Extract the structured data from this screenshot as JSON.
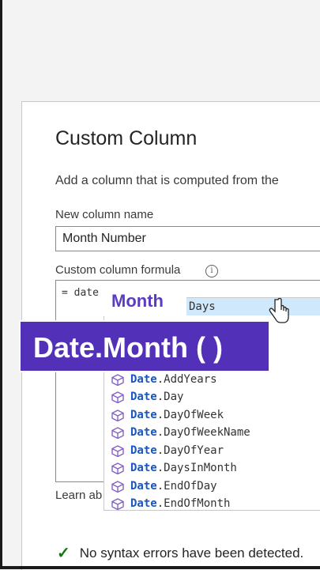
{
  "dialog": {
    "title": "Custom Column",
    "description": "Add a column that is computed from the",
    "name_label": "New column name",
    "name_value": "Month Number",
    "formula_label": "Custom column formula",
    "formula_value": "= date",
    "learn_link": "Learn ab",
    "status_text": "No syntax errors have been detected.",
    "status_icon": "check-icon",
    "status_color": "#107c10"
  },
  "suggestions": [
    {
      "prefix": "",
      "name": "Days",
      "selected": true
    },
    {
      "prefix": "Date",
      "name": ".AddYears"
    },
    {
      "prefix": "Date",
      "name": ".Day"
    },
    {
      "prefix": "Date",
      "name": ".DayOfWeek"
    },
    {
      "prefix": "Date",
      "name": ".DayOfWeekName"
    },
    {
      "prefix": "Date",
      "name": ".DayOfYear"
    },
    {
      "prefix": "Date",
      "name": ".DaysInMonth"
    },
    {
      "prefix": "Date",
      "name": ".EndOfDay"
    },
    {
      "prefix": "Date",
      "name": ".EndOfMonth"
    }
  ],
  "overlay": {
    "small_label": "Month",
    "banner_label": "Date.Month ( )",
    "accent_color": "#5230b8"
  }
}
